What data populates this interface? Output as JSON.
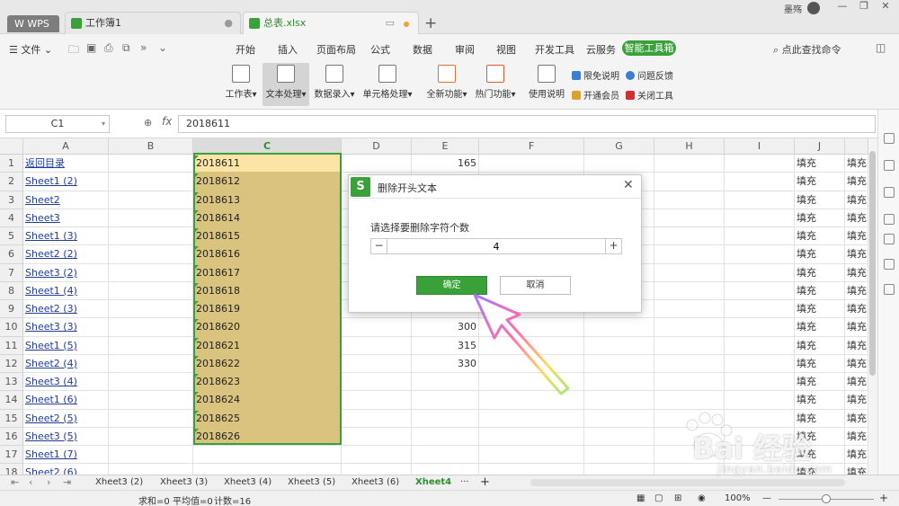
{
  "titlebar": {
    "app_tab": "WPS",
    "tabs": [
      {
        "label": "工作簿1"
      },
      {
        "label": "总表.xlsx"
      }
    ],
    "user_name": "墨殇",
    "win_controls": [
      "—",
      "❐",
      "✕"
    ]
  },
  "menu": {
    "file_label": "文件",
    "items": [
      "开始",
      "插入",
      "页面布局",
      "公式",
      "数据",
      "审阅",
      "视图",
      "开发工具",
      "云服务"
    ],
    "active": "智能工具箱",
    "search": "点此查找命令"
  },
  "ribbon": {
    "buttons": [
      "工作表",
      "文本处理",
      "数据录入",
      "单元格处理",
      "全新功能",
      "热门功能",
      "使用说明"
    ],
    "small_links": [
      "限免说明",
      "问题反馈",
      "开通会员",
      "关闭工具"
    ],
    "colors": {
      "accent": "#3aa03a",
      "selection": "#d9c37f",
      "first_cell": "#fbe4a6"
    }
  },
  "formula_bar": {
    "cell_ref": "C1",
    "fx": "fx",
    "value": "2018611"
  },
  "grid": {
    "columns": [
      "A",
      "B",
      "C",
      "D",
      "E",
      "F",
      "G",
      "H",
      "I",
      "J",
      ""
    ],
    "rows": [
      "1",
      "2",
      "3",
      "4",
      "5",
      "6",
      "7",
      "8",
      "9",
      "10",
      "11",
      "12",
      "13",
      "14",
      "15",
      "16",
      "17",
      "18"
    ],
    "col_a": [
      "返回目录",
      "Sheet1 (2)",
      "Sheet2",
      "Sheet3",
      "Sheet1 (3)",
      "Sheet2 (2)",
      "Sheet3 (2)",
      "Sheet1 (4)",
      "Sheet2 (3)",
      "Sheet3 (3)",
      "Sheet1 (5)",
      "Sheet2 (4)",
      "Sheet3 (4)",
      "Sheet1 (6)",
      "Sheet2 (5)",
      "Sheet3 (5)",
      "Sheet1 (7)",
      "Sheet2 (6)"
    ],
    "col_c": [
      "2018611",
      "2018612",
      "2018613",
      "2018614",
      "2018615",
      "2018616",
      "2018617",
      "2018618",
      "2018619",
      "2018620",
      "2018621",
      "2018622",
      "2018623",
      "2018624",
      "2018625",
      "2018626"
    ],
    "col_e": [
      {
        "row": 0,
        "value": "165"
      },
      {
        "row": 9,
        "value": "300"
      },
      {
        "row": 10,
        "value": "315"
      },
      {
        "row": 11,
        "value": "330"
      }
    ],
    "fill_text": "填充"
  },
  "sheet_tabs": {
    "tabs": [
      "Xheet3 (2)",
      "Xheet3 (3)",
      "Xheet3 (4)",
      "Xheet3 (5)",
      "Xheet3 (6)",
      "Xheet4"
    ],
    "active": "Xheet4",
    "more": "···",
    "add": "+"
  },
  "status": {
    "sum": "求和=0",
    "avg": "平均值=0",
    "count": "计数=16",
    "zoom": "100%",
    "zoom_minus": "—",
    "zoom_plus": "+"
  },
  "dialog": {
    "logo": "S",
    "title": "删除开头文本",
    "label": "请选择要删除字符个数",
    "minus": "−",
    "plus": "+",
    "value": "4",
    "ok": "确定",
    "cancel": "取消",
    "close": "✕"
  },
  "watermark": {
    "text": "Bai 经验",
    "url": "jingyan.baidu.com"
  }
}
